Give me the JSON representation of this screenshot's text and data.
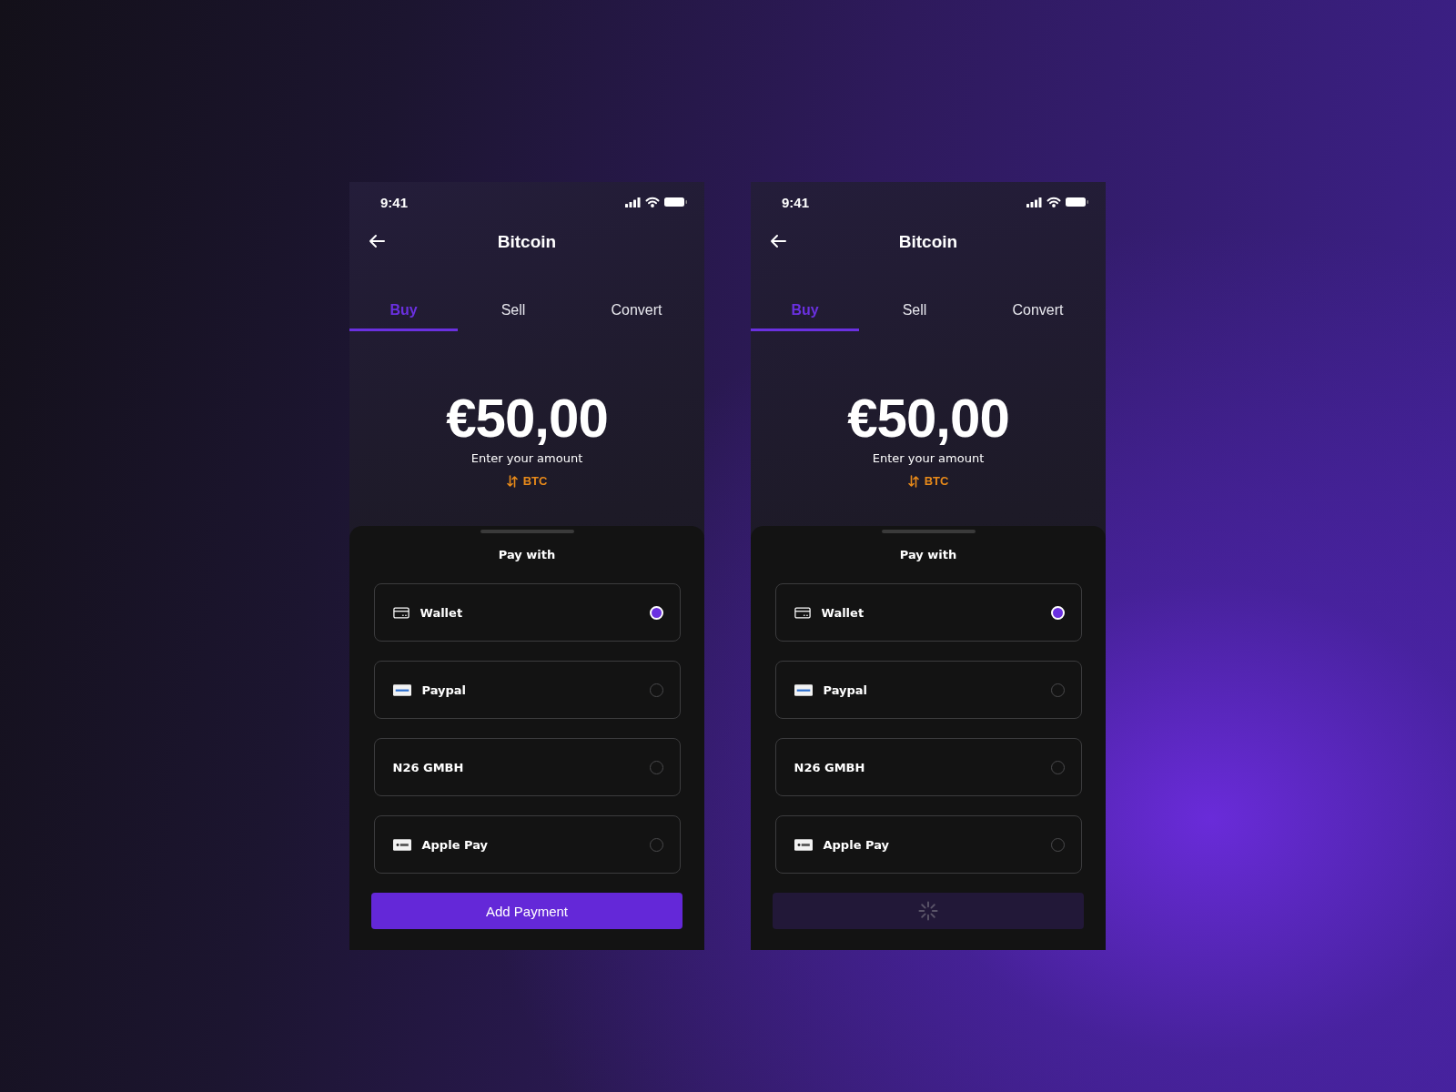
{
  "phones": [
    {
      "status_bar": {
        "time": "9:41"
      },
      "title": "Bitcoin",
      "tabs": [
        {
          "label": "Buy",
          "selected": true
        },
        {
          "label": "Sell",
          "selected": false
        },
        {
          "label": "Convert",
          "selected": false
        }
      ],
      "amount": "€50,00",
      "amount_hint": "Enter your amount",
      "currency": "BTC",
      "sheet": {
        "title": "Pay with",
        "options": [
          {
            "label": "Wallet",
            "kind": "card",
            "selected": true
          },
          {
            "label": "Paypal",
            "kind": "paypal",
            "selected": false
          },
          {
            "label": "N26 GMBH",
            "kind": "bank",
            "selected": false
          },
          {
            "label": "Apple Pay",
            "kind": "applepay",
            "selected": false
          }
        ],
        "button": {
          "label": "Add Payment",
          "loading": false
        }
      }
    },
    {
      "status_bar": {
        "time": "9:41"
      },
      "title": "Bitcoin",
      "tabs": [
        {
          "label": "Buy",
          "selected": true
        },
        {
          "label": "Sell",
          "selected": false
        },
        {
          "label": "Convert",
          "selected": false
        }
      ],
      "amount": "€50,00",
      "amount_hint": "Enter your amount",
      "currency": "BTC",
      "sheet": {
        "title": "Pay with",
        "options": [
          {
            "label": "Wallet",
            "kind": "card",
            "selected": true
          },
          {
            "label": "Paypal",
            "kind": "paypal",
            "selected": false
          },
          {
            "label": "N26 GMBH",
            "kind": "bank",
            "selected": false
          },
          {
            "label": "Apple Pay",
            "kind": "applepay",
            "selected": false
          }
        ],
        "button": {
          "loading": true
        }
      }
    }
  ]
}
